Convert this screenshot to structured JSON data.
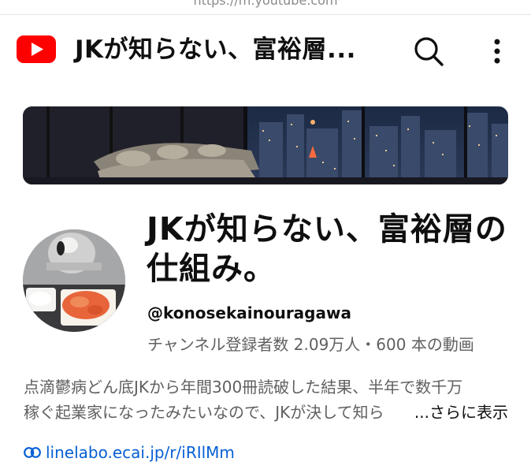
{
  "browser": {
    "url": "https://m.youtube.com"
  },
  "header": {
    "title": "JKが知らない、富裕層..."
  },
  "channel": {
    "name": "JKが知らない、富裕層の仕組み。",
    "handle": "@konosekainouragawa",
    "stats": "チャンネル登録者数 2.09万人・600 本の動画",
    "description_line1": "点滴鬱病どん底JKから年間300冊読破した結果、半年で数千万",
    "description_line2": "稼ぐ起業家になったみたいなので、JKが決して知ら",
    "more_label": "...さらに表示",
    "link": "linelabo.ecai.jp/r/iRIlMm"
  },
  "colors": {
    "brand_red": "#ff0000",
    "link_blue": "#065fd4",
    "secondary_text": "#606060"
  },
  "icons": [
    "youtube-logo-icon",
    "search-icon",
    "more-vert-icon",
    "link-icon"
  ]
}
